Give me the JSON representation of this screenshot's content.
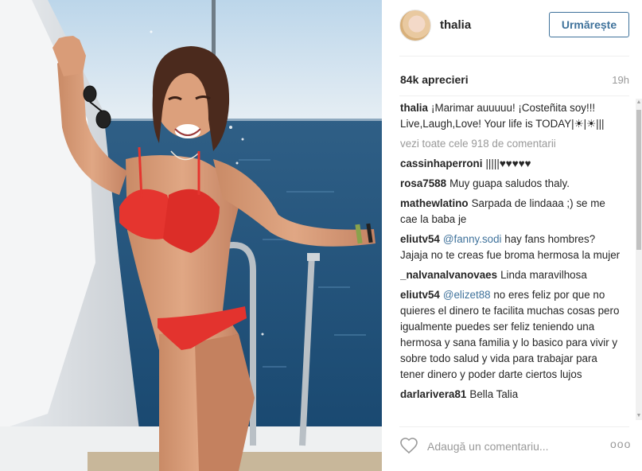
{
  "photo": {
    "alt_icon": "photo"
  },
  "header": {
    "username": "thalia",
    "follow_label": "Urmărește"
  },
  "stats": {
    "likes": "84k aprecieri",
    "time": "19h"
  },
  "caption": {
    "user": "thalia",
    "text": "¡Marimar auuuuu! ¡Costeñita soy!!! Live,Laugh,Love! Your life is TODAY|☀|☀|||"
  },
  "view_all": "vezi toate cele 918 de comentarii",
  "comments": [
    {
      "user": "cassinhaperroni",
      "mention": "",
      "text": "|||||♥♥♥♥♥"
    },
    {
      "user": "rosa7588",
      "mention": "",
      "text": "Muy guapa saludos thaly."
    },
    {
      "user": "mathewlatino",
      "mention": "",
      "text": "Sarpada de lindaaa ;) se me cae la baba je"
    },
    {
      "user": "eliutv54",
      "mention": "@fanny.sodi",
      "text": "hay fans hombres? Jajaja no te creas fue broma hermosa la mujer"
    },
    {
      "user": "_nalvanalvanovaes",
      "mention": "",
      "text": "Linda maravilhosa"
    },
    {
      "user": "eliutv54",
      "mention": "@elizet88",
      "text": "no eres feliz por que no quieres el dinero te facilita muchas cosas pero igualmente puedes ser feliz teniendo una hermosa y sana familia y lo basico para vivir y sobre todo salud y vida para trabajar para tener dinero y poder darte ciertos lujos"
    },
    {
      "user": "darlarivera81",
      "mention": "",
      "text": "Bella Talia"
    }
  ],
  "footer": {
    "placeholder": "Adaugă un comentariu...",
    "more": "ooo"
  }
}
